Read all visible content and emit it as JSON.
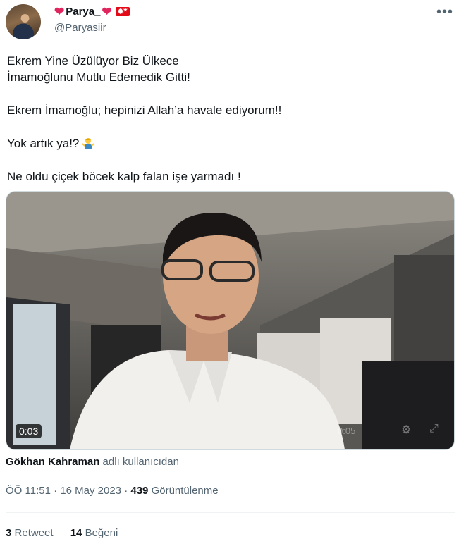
{
  "author": {
    "display_name_left_emoji": "❤️",
    "display_name": "Parya_",
    "display_name_right_emoji": "❤️",
    "flag_icon": "turkey-flag-icon",
    "handle": "@Paryasiir"
  },
  "menu_icon": "more-options-icon",
  "tweet": {
    "line1": "Ekrem Yine Üzülüyor Biz Ülkece",
    "line2": "İmamoğlunu Mutlu Edemedik Gitti!",
    "line3": "Ekrem İmamoğlu; hepinizi Allah’a havale ediyorum!!",
    "line4": "Yok artık ya!?",
    "line4_emoji": "person-shrugging-icon",
    "line5": "Ne oldu çiçek böcek kalp falan işe yarmadı !"
  },
  "video": {
    "duration_badge": "0:03",
    "overlay_time": "0:05"
  },
  "attribution": {
    "user": "Gökhan Kahraman",
    "suffix": "adlı kullanıcıdan"
  },
  "meta": {
    "time": "ÖÖ 11:51",
    "separator1": "·",
    "date": "16 May 2023",
    "separator2": "·",
    "views_count": "439",
    "views_label": "Görüntülenme"
  },
  "stats": {
    "retweets_count": "3",
    "retweets_label": "Retweet",
    "likes_count": "14",
    "likes_label": "Beğeni"
  },
  "colors": {
    "heart": "#e0245e",
    "secondary_text": "#536471",
    "primary_text": "#0f1419"
  }
}
